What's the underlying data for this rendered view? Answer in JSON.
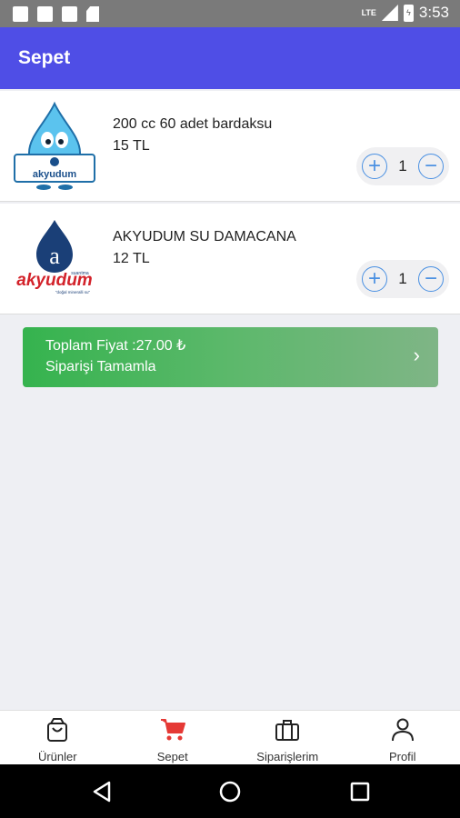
{
  "status_bar": {
    "network": "LTE",
    "time": "3:53"
  },
  "app_bar": {
    "title": "Sepet"
  },
  "cart": {
    "items": [
      {
        "name": "200 cc 60 adet bardaksu",
        "price": "15 TL",
        "quantity": "1",
        "logo_text": "akyudum"
      },
      {
        "name": "AKYUDUM SU DAMACANA",
        "price": "12 TL",
        "quantity": "1",
        "logo_text": "akyudum",
        "logo_small": "suarıtma",
        "logo_tag": "\"doğal mineralli su\""
      }
    ]
  },
  "checkout": {
    "total_label": "Toplam Fiyat :27.00 ₺",
    "action_label": "Siparişi Tamamla"
  },
  "bottom_nav": {
    "items": [
      {
        "label": "Ürünler",
        "icon": "bag-icon"
      },
      {
        "label": "Sepet",
        "icon": "cart-icon",
        "active": true
      },
      {
        "label": "Siparişlerim",
        "icon": "briefcase-icon"
      },
      {
        "label": "Profil",
        "icon": "person-icon"
      }
    ]
  },
  "colors": {
    "primary": "#4f4ee6",
    "accent_red": "#e53935",
    "checkout_green": "#35b34e",
    "qty_blue": "#4a90e2"
  }
}
